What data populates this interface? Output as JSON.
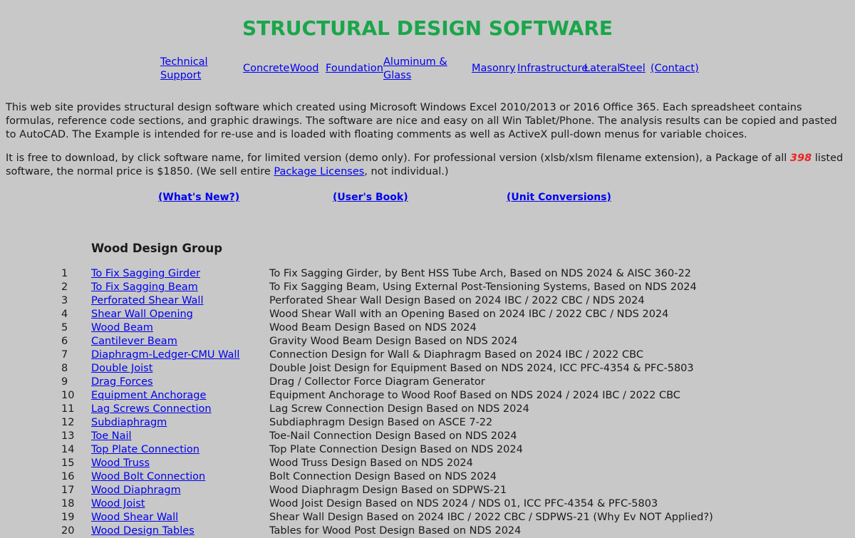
{
  "title": "STRUCTURAL DESIGN SOFTWARE",
  "nav": [
    {
      "line1": "Technical",
      "line2": "Support"
    },
    {
      "line1": "Concrete"
    },
    {
      "line1": "Wood"
    },
    {
      "line1": "Foundation"
    },
    {
      "line1": "Aluminum &",
      "line2": "Glass"
    },
    {
      "line1": "Masonry"
    },
    {
      "line1": "Infrastructure"
    },
    {
      "line1": "Lateral"
    },
    {
      "line1": "Steel"
    },
    {
      "line1": "(Contact)"
    }
  ],
  "intro1": "This web site provides structural design software which created using Microsoft Windows Excel 2010/2013 or 2016 Office 365. Each spreadsheet contains formulas, reference code sections, and graphic drawings. The software are nice and easy on all Win Tablet/Phone. The analysis results can be copied and pasted to AutoCAD. The Example is intended for re-use and is loaded with floating comments as well as ActiveX pull-down menus for variable choices.",
  "intro2": {
    "before": "It is free to download, by click software name, for limited version (demo only). For professional version (xlsb/xlsm filename extension), a Package of all ",
    "count": "398",
    "middle": " listed software, the normal price is $1850. (We sell entire ",
    "link": "Package Licenses",
    "after": ", not individual.)"
  },
  "links": {
    "whats_new": "(What's New?)",
    "users_book": "(User's Book)",
    "unit_conversions": "(Unit Conversions)"
  },
  "group_title": "Wood Design Group",
  "items": [
    {
      "num": "1",
      "name": "To Fix Sagging Girder",
      "desc": "To Fix Sagging Girder, by Bent HSS Tube Arch, Based on NDS 2024 & AISC 360-22"
    },
    {
      "num": "2",
      "name": "To Fix Sagging Beam",
      "desc": "To Fix Sagging Beam, Using External Post-Tensioning Systems, Based on NDS 2024"
    },
    {
      "num": "3",
      "name": "Perforated Shear Wall",
      "desc": "Perforated Shear Wall Design Based on 2024 IBC / 2022 CBC / NDS 2024"
    },
    {
      "num": "4",
      "name": "Shear Wall Opening",
      "desc": "Wood Shear Wall with an Opening Based on 2024 IBC / 2022 CBC / NDS 2024"
    },
    {
      "num": "5",
      "name": "Wood Beam",
      "desc": "Wood Beam Design Based on NDS 2024"
    },
    {
      "num": "6",
      "name": "Cantilever Beam",
      "desc": "Gravity Wood Beam Design Based on NDS 2024"
    },
    {
      "num": "7",
      "name": "Diaphragm-Ledger-CMU Wall",
      "desc": "Connection Design for Wall & Diaphragm Based on 2024 IBC / 2022 CBC"
    },
    {
      "num": "8",
      "name": "Double Joist",
      "desc": "Double Joist Design for Equipment Based on NDS 2024, ICC PFC-4354 & PFC-5803"
    },
    {
      "num": "9",
      "name": "Drag Forces",
      "desc": "Drag / Collector Force Diagram Generator"
    },
    {
      "num": "10",
      "name": "Equipment Anchorage",
      "desc": "Equipment Anchorage to Wood Roof Based on NDS 2024 / 2024 IBC / 2022 CBC"
    },
    {
      "num": "11",
      "name": "Lag Screws Connection",
      "desc": "Lag Screw Connection Design Based on NDS 2024"
    },
    {
      "num": "12",
      "name": "Subdiaphragm",
      "desc": "Subdiaphragm Design Based on ASCE 7-22"
    },
    {
      "num": "13",
      "name": "Toe Nail",
      "desc": "Toe-Nail Connection Design Based on NDS 2024"
    },
    {
      "num": "14",
      "name": "Top Plate Connection",
      "desc": "Top Plate Connection Design Based on NDS 2024"
    },
    {
      "num": "15",
      "name": "Wood Truss",
      "desc": "Wood Truss Design Based on NDS 2024"
    },
    {
      "num": "16",
      "name": "Wood Bolt Connection",
      "desc": "Bolt Connection Design Based on NDS 2024"
    },
    {
      "num": "17",
      "name": "Wood Diaphragm",
      "desc": "Wood Diaphragm Design Based on SDPWS-21"
    },
    {
      "num": "18",
      "name": "Wood Joist",
      "desc": "Wood Joist Design Based on NDS 2024 / NDS 01, ICC PFC-4354 & PFC-5803"
    },
    {
      "num": "19",
      "name": "Wood Shear Wall",
      "desc": "Shear Wall Design Based on 2024 IBC / 2022 CBC / SDPWS-21 (Why Ev NOT Applied?)"
    },
    {
      "num": "20",
      "name": "Wood Design Tables",
      "desc": "Tables for Wood Post Design Based on NDS 2024"
    }
  ],
  "colors": {
    "background": "#c8c8c8",
    "title": "#1aa64a",
    "link": "#0000ee",
    "count": "#ee2222"
  }
}
